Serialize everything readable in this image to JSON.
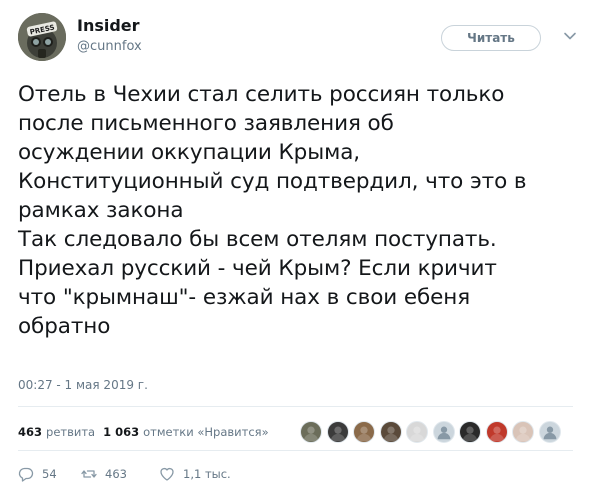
{
  "author": {
    "name": "Insider",
    "handle": "@cunnfox",
    "avatar_badge": "PRESS"
  },
  "follow_button": {
    "label": "Читать"
  },
  "tweet": {
    "lines": [
      "Отель в Чехии стал селить россиян только",
      "после письменного заявления об",
      "осуждении оккупации Крыма,",
      "Конституционный суд подтвердил, что это в",
      "рамках закона",
      "Так следовало бы всем отелям поступать.",
      "Приехал русский - чей Крым? Если кричит",
      "что \"крымнаш\"- езжай нах в свои ебеня",
      "обратно"
    ],
    "timestamp": "00:27 - 1 мая 2019 г."
  },
  "stats": {
    "retweets_count": "463",
    "retweets_label": "ретвита",
    "likes_count": "1 063",
    "likes_label": "отметки «Нравится»"
  },
  "likers": [
    {
      "icon": "liker-avatar",
      "color": "#6b6d5a"
    },
    {
      "icon": "liker-avatar",
      "color": "#3b3b3b"
    },
    {
      "icon": "liker-avatar",
      "color": "#8a6a4a"
    },
    {
      "icon": "liker-avatar",
      "color": "#5a4a3a"
    },
    {
      "icon": "liker-avatar",
      "color": "#d8d8d8"
    },
    {
      "icon": "default-avatar",
      "color": "#ccd6dd"
    },
    {
      "icon": "liker-avatar",
      "color": "#2a2a2a"
    },
    {
      "icon": "liker-avatar",
      "color": "#c0392b"
    },
    {
      "icon": "liker-avatar",
      "color": "#d9c4b8"
    },
    {
      "icon": "default-avatar",
      "color": "#ccd6dd"
    }
  ],
  "actions": {
    "replies": "54",
    "retweets": "463",
    "likes": "1,1 тыс."
  },
  "colors": {
    "text": "#14171a",
    "secondary": "#657786",
    "divider": "#e6ecf0"
  }
}
